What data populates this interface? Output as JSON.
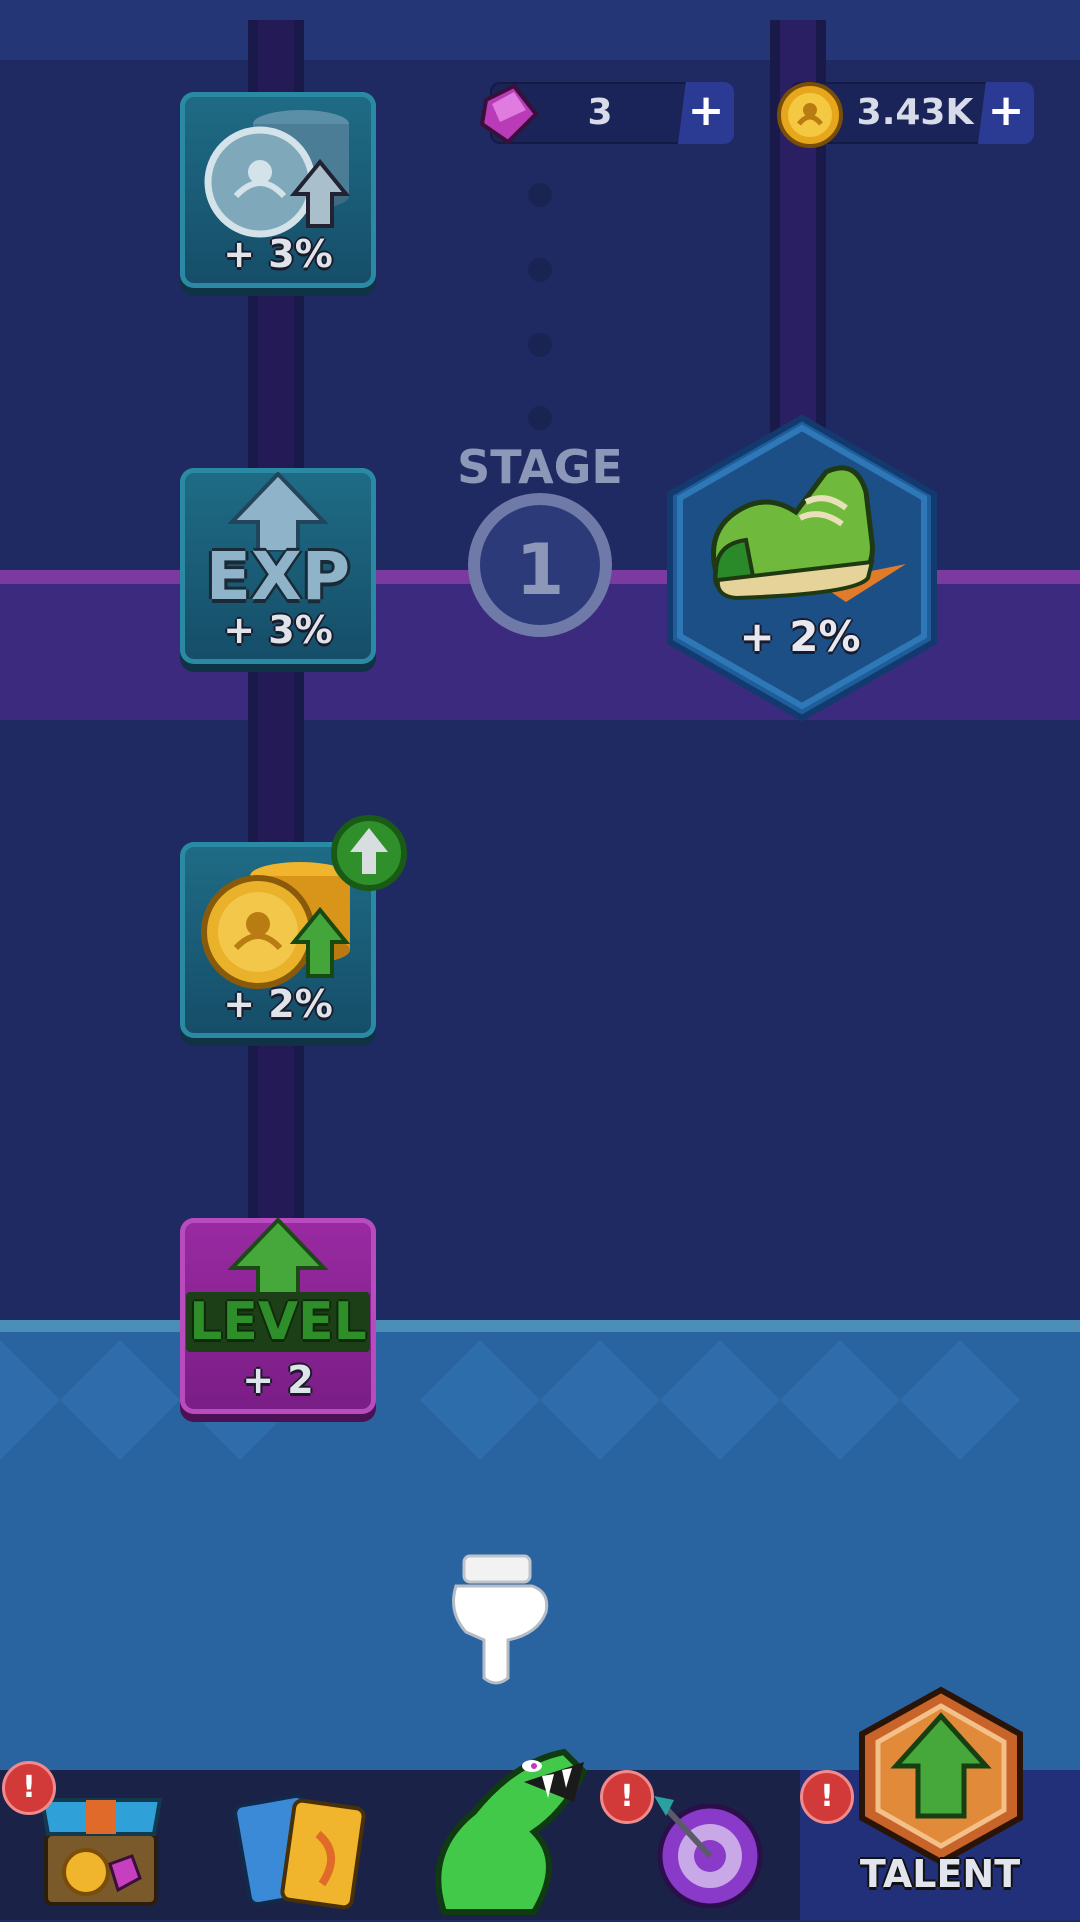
{
  "currencies": {
    "gems": {
      "value": "3",
      "plus": "+"
    },
    "coins": {
      "value": "3.43K",
      "plus": "+"
    }
  },
  "talents": [
    {
      "id": "coin-income",
      "bonus": "+ 3%"
    },
    {
      "id": "exp",
      "icon_text": "EXP",
      "bonus": "+ 3%"
    },
    {
      "id": "coin-gain",
      "bonus": "+ 2%"
    },
    {
      "id": "level",
      "icon_text": "LEVEL",
      "bonus": "+ 2"
    }
  ],
  "stage": {
    "title": "STAGE",
    "number": "1"
  },
  "speed_talent": {
    "bonus": "+ 2%"
  },
  "nav": {
    "alert_glyph": "!",
    "talent_label": "TALENT"
  },
  "colors": {
    "background": "#1f2a63",
    "stage_band": "#3a2a7a",
    "water": "#2c6aa0",
    "alert": "#d23a3a"
  }
}
